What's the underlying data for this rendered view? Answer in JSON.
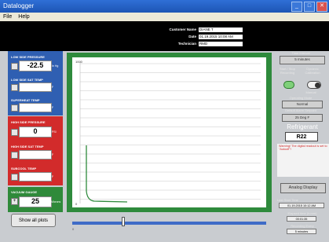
{
  "window": {
    "title": "Datalogger",
    "min": "_",
    "max": "□",
    "close": "✕"
  },
  "menu": [
    "File",
    "Help"
  ],
  "info": {
    "customer_label": "Customer Name",
    "customer_value": "DIANE T",
    "date_label": "Date",
    "date_value": "01.19.2015 10:08 AM",
    "technician_label": "Technician",
    "technician_value": "RMD"
  },
  "left": {
    "low_pressure_label": "LOW SIDE PRESSURE",
    "low_pressure_value": "-22.5",
    "low_pressure_unit": "In Hg",
    "low_sat_temp_label": "LOW SIDE SAT TEMP",
    "low_sat_temp_unit": "F",
    "superheat_label": "SUPERHEAT TEMP",
    "superheat_unit": "F",
    "high_pressure_label": "HIGH SIDE PRESSURE",
    "high_pressure_value": "0",
    "high_pressure_unit": "PSI",
    "high_sat_temp_label": "HIGH SIDE SAT TEMP",
    "high_sat_temp_unit": "F",
    "subcool_label": "SUBCOOL TEMP",
    "subcool_unit": "F",
    "vacuum_label": "VACUUM GAUGE",
    "vacuum_value": "25",
    "vacuum_unit": "Microns",
    "vacuum_sign": "+"
  },
  "chart": {
    "ytop": "1000",
    "ybottom": "0"
  },
  "right": {
    "interval_label": "Time Interval",
    "interval_value": "5 minutes",
    "start_stop_label": "Start / Stop Recording",
    "dyncal_label": "Dynamic Calibration",
    "manual_label": "Manual",
    "mode_label": "Operating Mode",
    "mode_value": "Normal",
    "setpoint_label": "Default Alarm Setpoint",
    "setpoint_value": "25 Deg F",
    "refrigerant_label": "Refrigerant",
    "refrigerant_value": "R22",
    "warning": "Warning! The digital readout is set to \"Autooff\"!",
    "analog_button": "Analog Display",
    "last_start_label": "Last Start Time",
    "last_start_value": "01.19.2015 10:12 AM",
    "elapsed_label": "Elapsed time (h:mm)",
    "elapsed_value": "00:01:35",
    "recording_label": "Recording Every",
    "recording_value": "5 minutes"
  },
  "bottom": {
    "show_all": "Show all plots",
    "ticks": [
      "0",
      "",
      "",
      "",
      "",
      ""
    ]
  }
}
